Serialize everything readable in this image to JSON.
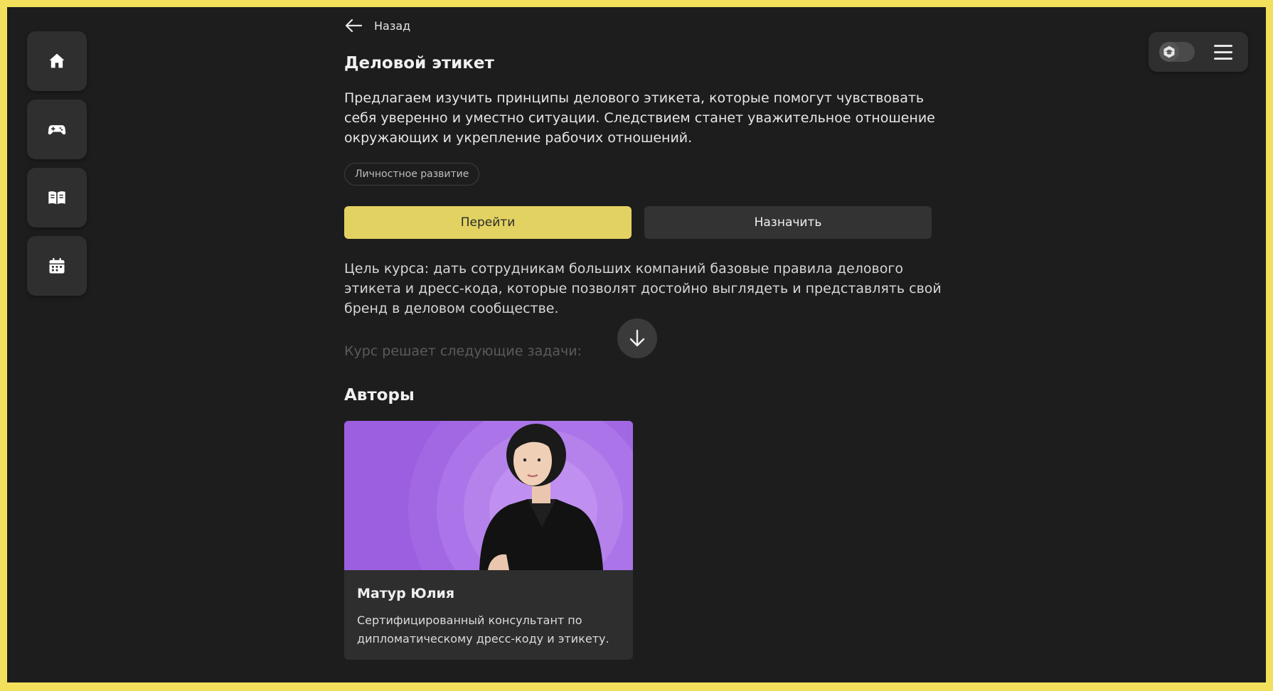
{
  "nav": {
    "items": [
      {
        "icon": "home-icon"
      },
      {
        "icon": "gamepad-icon"
      },
      {
        "icon": "book-icon"
      },
      {
        "icon": "calendar-icon"
      }
    ]
  },
  "topbar": {
    "toggle_icon": "graduation-cap-icon",
    "menu_icon": "menu-icon"
  },
  "back": {
    "label": "Назад"
  },
  "course": {
    "title": "Деловой этикет",
    "description": "Предлагаем изучить принципы делового этикета, которые помогут чувствовать себя уверенно и уместно ситуации. Следствием станет уважительное отношение окружающих и укрепление рабочих отношений.",
    "tag": "Личностное развитие",
    "primary_button": "Перейти",
    "secondary_button": "Назначить",
    "goal": "Цель курса: дать сотрудникам больших компаний базовые правила делового этикета и дресс-кода, которые позволят достойно выглядеть и представлять свой бренд в деловом сообществе.",
    "tasks_intro": "Курс решает следующие задачи:"
  },
  "authors": {
    "heading": "Авторы",
    "items": [
      {
        "name": "Матур Юлия",
        "bio": "Сертифицированный консультант по дипломатическому дресс-коду и этикету."
      }
    ]
  },
  "colors": {
    "accent": "#e2d262",
    "background": "#1d1d1d",
    "border_frame": "#f2df5c",
    "photo_bg": "#9b5fe0"
  }
}
